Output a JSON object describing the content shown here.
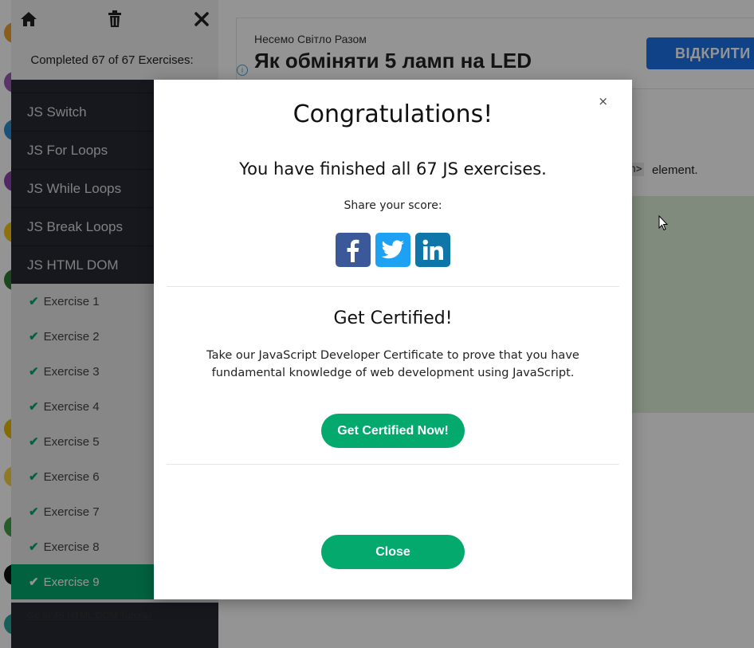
{
  "sidebar": {
    "completed_text": "Completed 67 of 67 Exercises:",
    "nav_items": [
      {
        "label": "JS Switch"
      },
      {
        "label": "JS For Loops"
      },
      {
        "label": "JS While Loops"
      },
      {
        "label": "JS Break Loops"
      },
      {
        "label": "JS HTML DOM"
      }
    ],
    "exercises": [
      {
        "label": "Exercise 1"
      },
      {
        "label": "Exercise 2"
      },
      {
        "label": "Exercise 3"
      },
      {
        "label": "Exercise 4"
      },
      {
        "label": "Exercise 5"
      },
      {
        "label": "Exercise 6"
      },
      {
        "label": "Exercise 7"
      },
      {
        "label": "Exercise 8"
      },
      {
        "label": "Exercise 9"
      }
    ],
    "tutorial_link": "Go to JS HTML DOM Tutorial",
    "icons": {
      "home": "home-icon",
      "trash": "trash-icon",
      "close": "close-icon"
    }
  },
  "ad": {
    "small_text": "Несемо Світло Разом",
    "title": "Як обміняти 5 ламп на LED",
    "button_label": "ВІДКРИТИ",
    "info_icon": "i"
  },
  "content": {
    "code_fragment": "n>",
    "element_text": "element."
  },
  "modal": {
    "close_symbol": "×",
    "title": "Congratulations!",
    "finished_text": "You have finished all 67 JS exercises.",
    "share_label": "Share your score:",
    "social": [
      "facebook-icon",
      "twitter-icon",
      "linkedin-icon"
    ],
    "cert_title": "Get Certified!",
    "cert_text": "Take our JavaScript Developer Certificate to prove that you have fundamental knowledge of web development using JavaScript.",
    "cert_button": "Get Certified Now!",
    "close_button": "Close"
  },
  "colors": {
    "accent_green": "#04aa6d",
    "sidebar_dark": "#282a35",
    "facebook": "#3b5998",
    "twitter": "#1da1f2",
    "linkedin": "#0e76a8",
    "ad_button": "#1a73e8"
  }
}
